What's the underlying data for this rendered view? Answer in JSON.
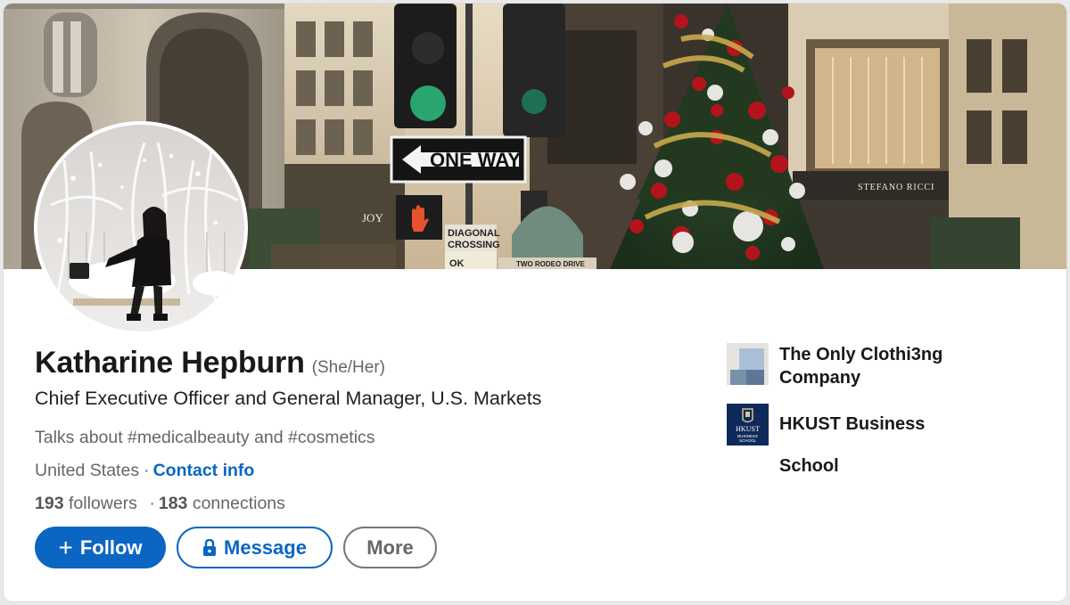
{
  "profile": {
    "name": "Katharine Hepburn",
    "pronouns": "(She/Her)",
    "headline": "Chief Executive Officer and General Manager, U.S. Markets",
    "talks_about": "Talks about #medicalbeauty and #cosmetics",
    "location": "United States",
    "separator": "·",
    "contact_info_label": "Contact info",
    "followers_count": "193",
    "followers_label": "followers",
    "connections_count": "183",
    "connections_label": "connections"
  },
  "cover": {
    "one_way_sign": "ONE WAY",
    "diagonal_sign_line1": "DIAGONAL",
    "diagonal_sign_line2": "CROSSING",
    "ok_sign": "OK",
    "street_sign": "TWO RODEO DRIVE",
    "store_name": "STEFANO RICCI",
    "store_name_lower": "STEFANO RICCI",
    "joy_sign": "JOY"
  },
  "actions": {
    "follow_label": "Follow",
    "follow_icon": "plus-icon",
    "message_label": "Message",
    "message_icon": "lock-icon",
    "more_label": "More"
  },
  "organizations": [
    {
      "name": "The Only Clothi3ng Company",
      "logo": "company-logo"
    },
    {
      "name": "HKUST Business School",
      "logo": "hkust-logo",
      "logo_text_1": "HKUST",
      "logo_text_2": "BUSINESS",
      "logo_text_3": "SCHOOL"
    }
  ],
  "colors": {
    "brand_blue": "#0a66c2",
    "text_primary": "#191919",
    "text_secondary": "#666666",
    "hkust_navy": "#0f2a5a"
  }
}
